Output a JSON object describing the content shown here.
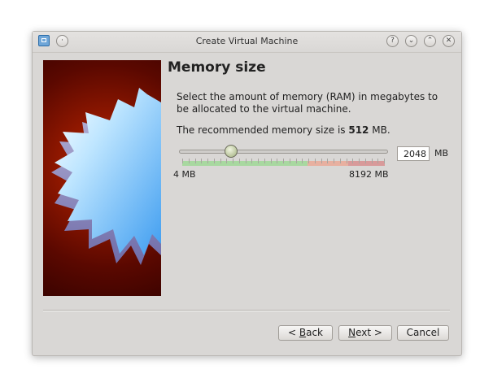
{
  "window": {
    "title": "Create Virtual Machine"
  },
  "titlebar": {
    "app_icon": "virtualbox-app-icon",
    "pin_button": "·",
    "help_button": "?",
    "minimize_button": "⌄",
    "maximize_button": "⌃",
    "close_button": "✕"
  },
  "page": {
    "heading": "Memory size",
    "description": "Select the amount of memory (RAM) in megabytes to be allocated to the virtual machine.",
    "recommended_prefix": "The recommended memory size is ",
    "recommended_value": "512",
    "recommended_suffix": " MB."
  },
  "memory": {
    "value": "2048",
    "unit": "MB",
    "min_label": "4 MB",
    "max_label": "8192 MB",
    "slider_fraction": 0.25
  },
  "buttons": {
    "back_prefix": "< ",
    "back_mnemonic": "B",
    "back_rest": "ack",
    "next_mnemonic": "N",
    "next_rest": "ext >",
    "cancel": "Cancel"
  },
  "colors": {
    "safe_zone": "#a8d8a0",
    "warn_zone": "#e8b0a0",
    "danger_zone": "#d89a9a",
    "image_bg": "#8e1700"
  }
}
